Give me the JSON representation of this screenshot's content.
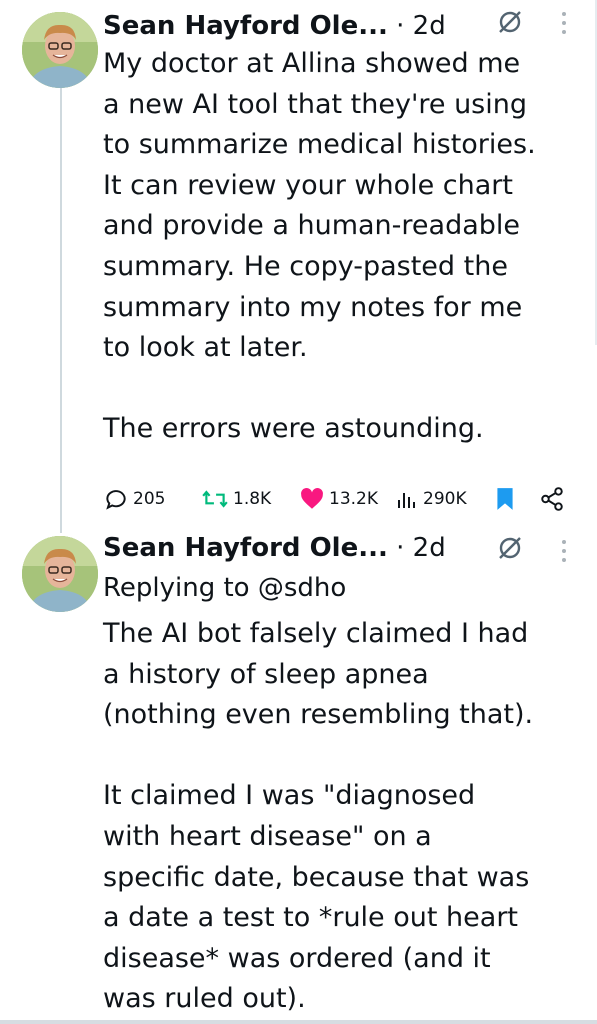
{
  "tweets": [
    {
      "author": "Sean Hayford Ole...",
      "time": "· 2d",
      "body": "My doctor at Allina showed me\na new AI tool that they're using\nto summarize medical histories.\nIt can review your whole chart\nand provide a human-readable\nsummary. He copy-pasted the\nsummary into my notes for me\nto look at later.\n\nThe errors were astounding.",
      "actions": {
        "replies": "205",
        "retweets": "1.8K",
        "likes": "13.2K",
        "views": "290K"
      }
    },
    {
      "author": "Sean Hayford Ole...",
      "time": "· 2d",
      "reply_to_prefix": "Replying to ",
      "reply_to_handle": "@sdho",
      "body": "The AI bot falsely claimed I had\na history of sleep apnea\n(nothing even resembling that).\n\nIt claimed I was \"diagnosed\nwith heart disease\" on a\nspecific date, because that was\na date a test to *rule out heart\ndisease* was ordered (and it\nwas ruled out)."
    }
  ],
  "colors": {
    "like": "#f91880",
    "retweet": "#00ba7c",
    "bookmark": "#1d9bf0",
    "thread_line": "#cfd9de"
  },
  "icons": [
    "reply-icon",
    "retweet-icon",
    "like-icon",
    "views-icon",
    "bookmark-icon",
    "share-icon",
    "hide-icon",
    "more-icon"
  ]
}
